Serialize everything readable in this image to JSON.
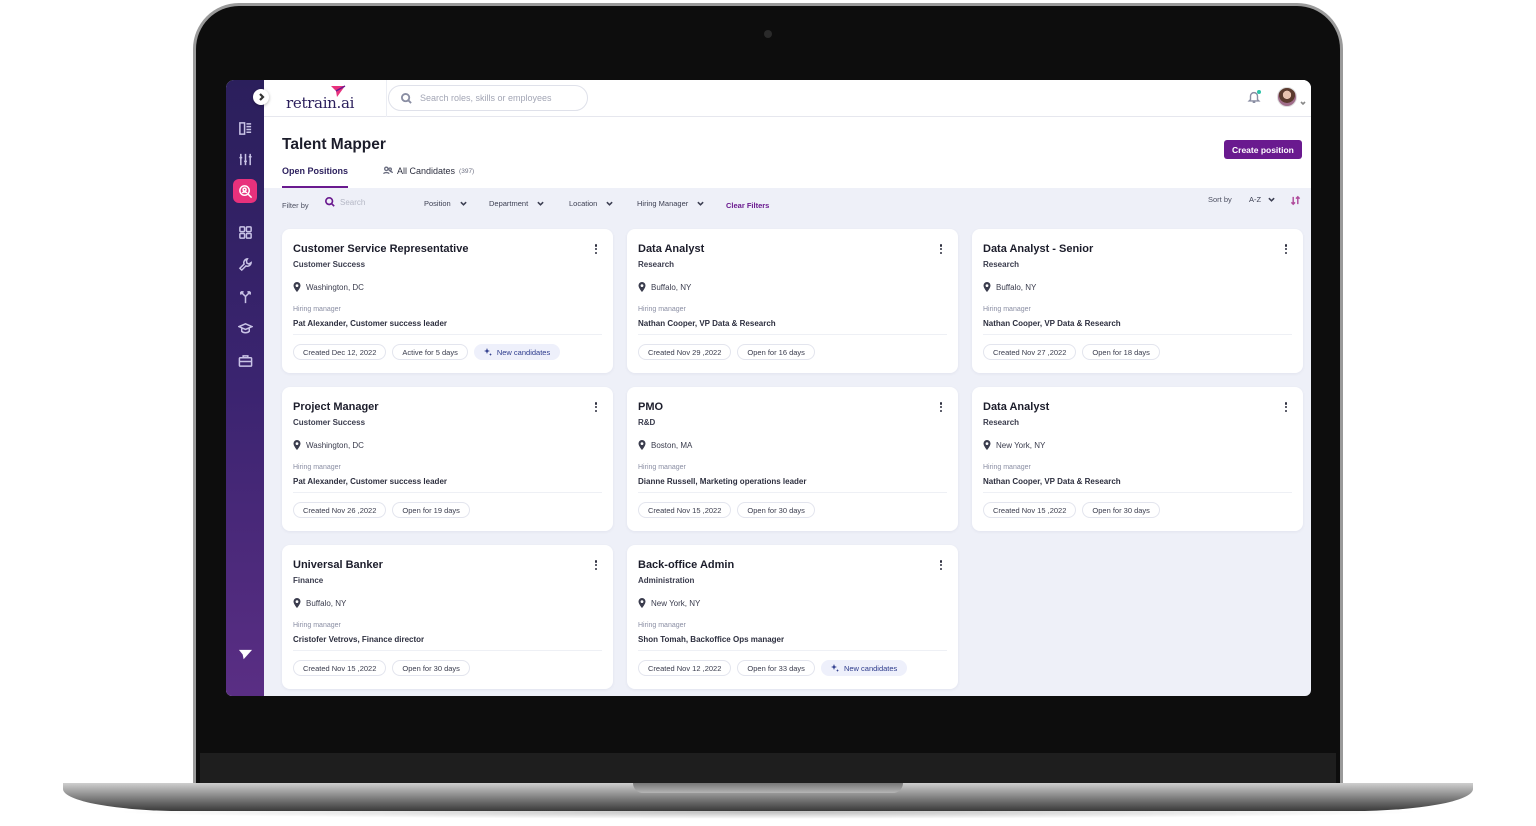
{
  "app": {
    "logo_text": "retrain.ai"
  },
  "topbar": {
    "search_placeholder": "Search roles, skills or employees",
    "icons": [
      "search-icon",
      "bell-icon",
      "avatar"
    ]
  },
  "sidebar": {
    "items": [
      {
        "name": "dashboard-icon"
      },
      {
        "name": "sliders-icon"
      },
      {
        "name": "talent-search-icon",
        "active": true
      },
      {
        "name": "apps-grid-icon"
      },
      {
        "name": "wrench-icon"
      },
      {
        "name": "paths-icon"
      },
      {
        "name": "graduation-cap-icon"
      },
      {
        "name": "briefcase-icon"
      }
    ],
    "accent": "#e8317c"
  },
  "page": {
    "title": "Talent Mapper",
    "create_button": "Create position",
    "tabs": [
      {
        "label": "Open Positions",
        "active": true
      },
      {
        "label": "All Candidates",
        "count": "(397)"
      }
    ]
  },
  "filters": {
    "label": "Filter by",
    "search_placeholder": "Search",
    "dropdowns": [
      "Position",
      "Department",
      "Location",
      "Hiring Manager"
    ],
    "clear": "Clear Filters",
    "sort_label": "Sort by",
    "sort_value": "A-Z"
  },
  "hm_label": "Hiring manager",
  "new_candidates_label": "New candidates",
  "cards": [
    {
      "title": "Customer Service Representative",
      "dept": "Customer Success",
      "location": "Washington, DC",
      "hiring_manager": "Pat Alexander, Customer success leader",
      "created": "Created Dec 12, 2022",
      "status": "Active for 5 days",
      "new_candidates": true
    },
    {
      "title": "Data Analyst",
      "dept": "Research",
      "location": "Buffalo, NY",
      "hiring_manager": "Nathan Cooper, VP Data & Research",
      "created": "Created Nov 29 ,2022",
      "status": "Open for 16 days",
      "new_candidates": false
    },
    {
      "title": "Data Analyst - Senior",
      "dept": "Research",
      "location": "Buffalo, NY",
      "hiring_manager": "Nathan Cooper, VP Data & Research",
      "created": "Created Nov 27 ,2022",
      "status": "Open for 18 days",
      "new_candidates": false
    },
    {
      "title": "Project Manager",
      "dept": "Customer Success",
      "location": "Washington, DC",
      "hiring_manager": "Pat Alexander, Customer success leader",
      "created": "Created Nov 26 ,2022",
      "status": "Open for 19 days",
      "new_candidates": false
    },
    {
      "title": "PMO",
      "dept": "R&D",
      "location": "Boston, MA",
      "hiring_manager": "Dianne Russell, Marketing operations leader",
      "created": "Created Nov 15 ,2022",
      "status": "Open for 30 days",
      "new_candidates": false
    },
    {
      "title": "Data Analyst",
      "dept": "Research",
      "location": "New York, NY",
      "hiring_manager": "Nathan Cooper, VP Data & Research",
      "created": "Created Nov 15 ,2022",
      "status": "Open for 30 days",
      "new_candidates": false
    },
    {
      "title": "Universal Banker",
      "dept": "Finance",
      "location": "Buffalo, NY",
      "hiring_manager": "Cristofer Vetrovs, Finance director",
      "created": "Created Nov 15 ,2022",
      "status": "Open for 30 days",
      "new_candidates": false
    },
    {
      "title": "Back-office Admin",
      "dept": "Administration",
      "location": "New York, NY",
      "hiring_manager": "Shon Tomah, Backoffice Ops manager",
      "created": "Created Nov 12 ,2022",
      "status": "Open for 33 days",
      "new_candidates": true
    }
  ],
  "colors": {
    "primary": "#6a1a8f",
    "sidebar": "#2b1f5c",
    "background": "#eef0f8"
  }
}
